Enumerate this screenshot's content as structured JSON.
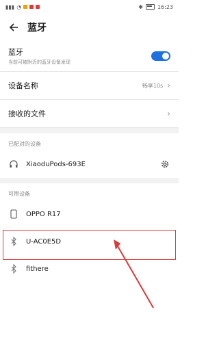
{
  "status_bar": {
    "time": "16:23"
  },
  "header": {
    "title": "蓝牙"
  },
  "bluetooth": {
    "label": "蓝牙",
    "subtitle": "当前可被附近的蓝牙设备发现",
    "enabled": true
  },
  "device_name": {
    "label": "设备名称",
    "value": "畅享10s"
  },
  "received_files": {
    "label": "接收的文件"
  },
  "paired": {
    "section_label": "已配对的设备",
    "devices": [
      {
        "name": "XiaoduPods-693E",
        "icon": "headphones-icon"
      }
    ]
  },
  "available": {
    "section_label": "可用设备",
    "devices": [
      {
        "name": "OPPO R17",
        "icon": "phone-icon"
      },
      {
        "name": "U-AC0E5D",
        "icon": "bluetooth-icon"
      },
      {
        "name": "fithere",
        "icon": "bluetooth-icon"
      }
    ]
  },
  "colors": {
    "accent": "#1f71e0",
    "highlight": "#d93a3a"
  }
}
